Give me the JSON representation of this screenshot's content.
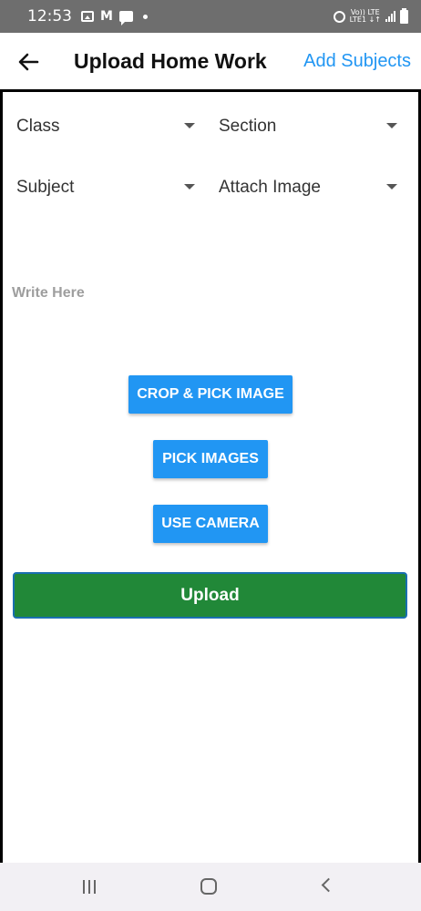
{
  "status_bar": {
    "time": "12:53",
    "volte_line1": "Vo)) LTE",
    "volte_line2": "LTE1 ↓↑"
  },
  "app_bar": {
    "title": "Upload Home Work",
    "action_label": "Add Subjects"
  },
  "form": {
    "class_dropdown": "Class",
    "section_dropdown": "Section",
    "subject_dropdown": "Subject",
    "attach_dropdown": "Attach Image",
    "text_placeholder": "Write Here"
  },
  "buttons": {
    "crop_pick": "CROP & PICK IMAGE",
    "pick_images": "PICK IMAGES",
    "use_camera": "USE CAMERA",
    "upload": "Upload"
  },
  "colors": {
    "accent": "#2196f3",
    "upload_green": "#218838",
    "status_bar": "#6e6e6e"
  }
}
